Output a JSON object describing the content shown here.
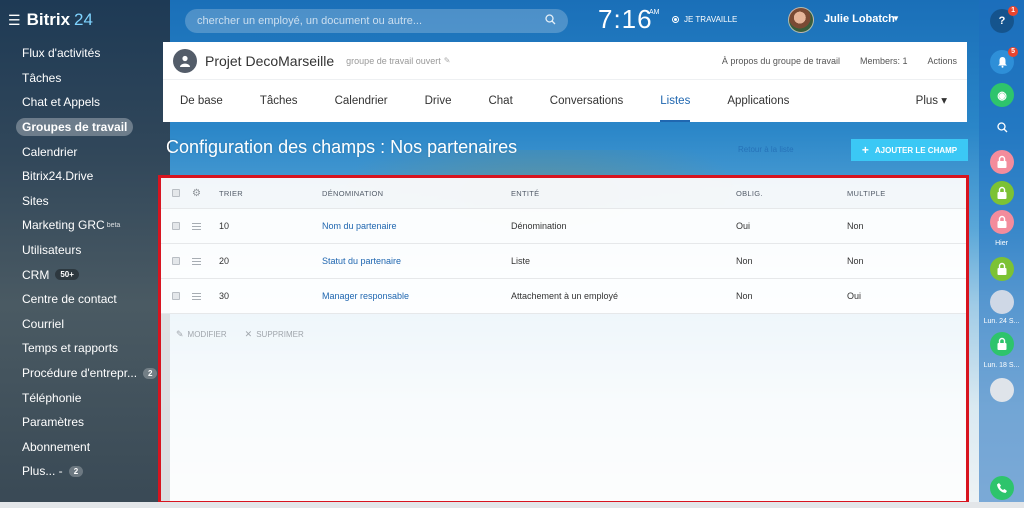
{
  "app": {
    "brand": "Bitrix",
    "brand_num": "24"
  },
  "search": {
    "placeholder": "chercher un employé, un document ou autre..."
  },
  "clock": {
    "time": "7:16",
    "ampm": "AM"
  },
  "work_status": "JE TRAVAILLE",
  "user": {
    "name": "Julie Lobatch"
  },
  "sidebar": {
    "items": [
      {
        "label": "Flux d'activités"
      },
      {
        "label": "Tâches"
      },
      {
        "label": "Chat et Appels"
      },
      {
        "label": "Groupes de travail",
        "active": true
      },
      {
        "label": "Calendrier"
      },
      {
        "label": "Bitrix24.Drive"
      },
      {
        "label": "Sites"
      },
      {
        "label": "Marketing GRC",
        "sup": "beta"
      },
      {
        "label": "Utilisateurs"
      },
      {
        "label": "CRM",
        "badge": "50+"
      },
      {
        "label": "Centre de contact"
      },
      {
        "label": "Courriel"
      },
      {
        "label": "Temps et rapports"
      },
      {
        "label": "Procédure d'entrepr...",
        "badge": "2"
      },
      {
        "label": "Téléphonie"
      },
      {
        "label": "Paramètres"
      },
      {
        "label": "Abonnement"
      },
      {
        "label": "Plus... -",
        "badge": "2"
      }
    ]
  },
  "group": {
    "name": "Projet DecoMarseille",
    "type": "groupe de travail ouvert",
    "about": "À propos du groupe de travail",
    "members": "Members: 1",
    "actions": "Actions"
  },
  "tabs": [
    {
      "label": "De base"
    },
    {
      "label": "Tâches"
    },
    {
      "label": "Calendrier"
    },
    {
      "label": "Drive"
    },
    {
      "label": "Chat"
    },
    {
      "label": "Conversations"
    },
    {
      "label": "Listes",
      "active": true
    },
    {
      "label": "Applications"
    }
  ],
  "tabs_more": "Plus ▾",
  "page": {
    "title": "Configuration des champs : Nos partenaires",
    "help": "Retour à la liste",
    "add_button": "AJOUTER LE CHAMP"
  },
  "grid": {
    "columns": [
      "TRIER",
      "DÉNOMINATION",
      "ENTITÉ",
      "OBLIG.",
      "MULTIPLE"
    ],
    "rows": [
      {
        "sort": "10",
        "name": "Nom du partenaire",
        "entity": "Dénomination",
        "required": "Oui",
        "multiple": "Non"
      },
      {
        "sort": "20",
        "name": "Statut du partenaire",
        "entity": "Liste",
        "required": "Non",
        "multiple": "Non"
      },
      {
        "sort": "30",
        "name": "Manager responsable",
        "entity": "Attachement à un employé",
        "required": "Non",
        "multiple": "Oui"
      }
    ],
    "actions": {
      "edit": "MODIFIER",
      "delete": "SUPPRIMER"
    }
  },
  "right_sidebar": {
    "help_badge": "1",
    "notif_badge": "5",
    "label_yesterday": "Hier",
    "label_chat1": "Lun. 24 S...",
    "label_chat2": "Lun. 18 S..."
  },
  "colors": {
    "accent": "#2067b0",
    "add_button": "#3bc8f5",
    "highlight_border": "#d8141f"
  }
}
